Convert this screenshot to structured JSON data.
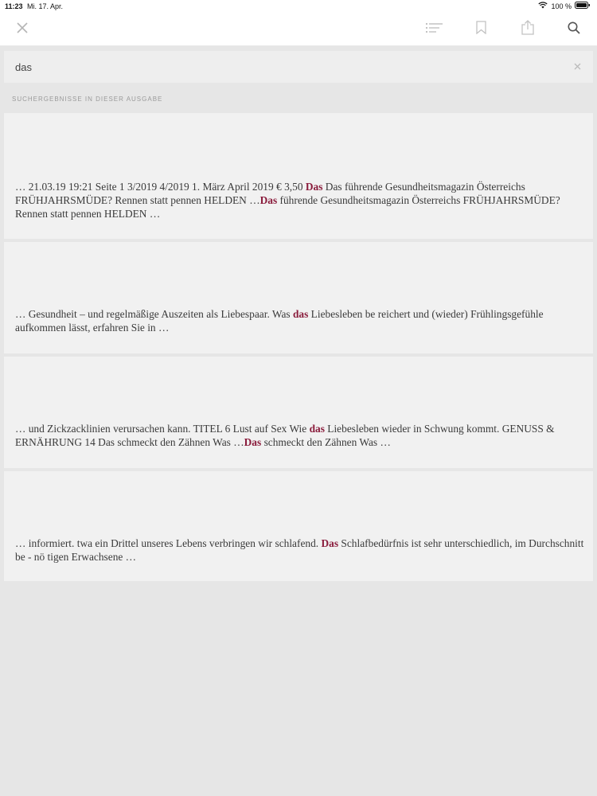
{
  "status_bar": {
    "time": "11:23",
    "date": "Mi. 17. Apr.",
    "battery": "100 %"
  },
  "toolbar": {
    "icons": [
      "close-icon",
      "table-of-contents-icon",
      "bookmark-icon",
      "share-icon",
      "search-icon"
    ]
  },
  "search": {
    "query": "das"
  },
  "section_header": "SUCHERGEBNISSE IN DIESER AUSGABE",
  "colors": {
    "highlight": "#8a1c3c",
    "card_background": "#f1f1f1",
    "page_background": "#e6e6e6"
  },
  "results": [
    {
      "segments": [
        {
          "t": "… 21.03.19 19:21 Seite 1 3/2019 4/2019 1. März April 2019 € 3,50 ",
          "h": false
        },
        {
          "t": "Das",
          "h": true
        },
        {
          "t": " Das führende Gesundheitsmagazin Österreichs FRÜHJAHRSMÜDE? Rennen statt pennen HELDEN …",
          "h": false
        },
        {
          "t": "Das",
          "h": true
        },
        {
          "t": " führende Gesundheitsmagazin Österreichs FRÜHJAHRSMÜDE? Rennen statt pennen HELDEN …",
          "h": false
        }
      ]
    },
    {
      "segments": [
        {
          "t": "… Gesundheit – und regelmäßige Auszeiten als Liebespaar. Was ",
          "h": false
        },
        {
          "t": "das",
          "h": true
        },
        {
          "t": " Liebesleben be reichert und (wieder) Frühlingsgefühle aufkommen lässt, erfahren Sie in …",
          "h": false
        }
      ]
    },
    {
      "segments": [
        {
          "t": "… und Zickzacklinien verursachen kann. TITEL 6 Lust auf Sex Wie ",
          "h": false
        },
        {
          "t": "das",
          "h": true
        },
        {
          "t": " Liebesleben wieder in Schwung kommt. GENUSS & ERNÄHRUNG 14 Das schmeckt den Zähnen Was …",
          "h": false
        },
        {
          "t": "Das",
          "h": true
        },
        {
          "t": " schmeckt den Zähnen Was …",
          "h": false
        }
      ]
    },
    {
      "segments": [
        {
          "t": "… informiert. twa ein Drittel unseres Lebens verbringen wir schlafend. ",
          "h": false
        },
        {
          "t": "Das",
          "h": true
        },
        {
          "t": " Schlafbedürfnis ist sehr unterschiedlich, im Durchschnitt be - nö tigen Erwachsene …",
          "h": false
        }
      ]
    }
  ]
}
